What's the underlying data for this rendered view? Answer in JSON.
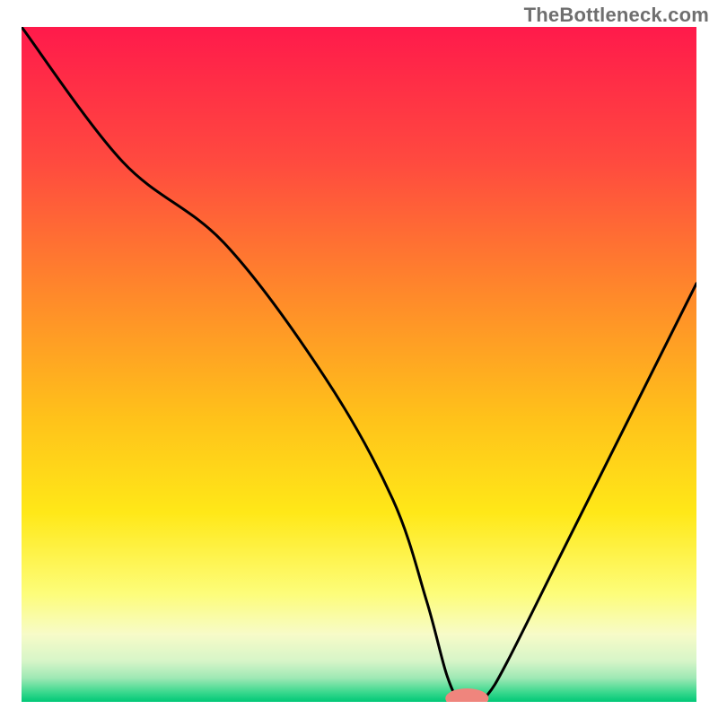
{
  "watermark": "TheBottleneck.com",
  "chart_data": {
    "type": "line",
    "title": "",
    "xlabel": "",
    "ylabel": "",
    "xlim": [
      0,
      100
    ],
    "ylim": [
      0,
      100
    ],
    "series": [
      {
        "name": "bottleneck-curve",
        "color": "#000000",
        "x": [
          0,
          15,
          30,
          45,
          55,
          60,
          63,
          65,
          67,
          69,
          72,
          80,
          90,
          100
        ],
        "values": [
          100,
          80,
          68,
          48,
          30,
          15,
          4,
          0,
          0,
          1,
          6,
          22,
          42,
          62
        ]
      }
    ],
    "marker": {
      "x": 66,
      "y": 0.5,
      "color": "#ef857d",
      "rx": 3.2,
      "ry": 1.5
    },
    "gradient_stops": [
      {
        "offset": 0.0,
        "color": "#ff1a4b"
      },
      {
        "offset": 0.2,
        "color": "#ff4a3f"
      },
      {
        "offset": 0.4,
        "color": "#ff8a2a"
      },
      {
        "offset": 0.58,
        "color": "#ffc21a"
      },
      {
        "offset": 0.72,
        "color": "#ffe818"
      },
      {
        "offset": 0.84,
        "color": "#fdfd7a"
      },
      {
        "offset": 0.9,
        "color": "#f7fbc8"
      },
      {
        "offset": 0.94,
        "color": "#d6f5c8"
      },
      {
        "offset": 0.965,
        "color": "#9de8b4"
      },
      {
        "offset": 0.985,
        "color": "#3ed98f"
      },
      {
        "offset": 1.0,
        "color": "#00c877"
      }
    ]
  }
}
